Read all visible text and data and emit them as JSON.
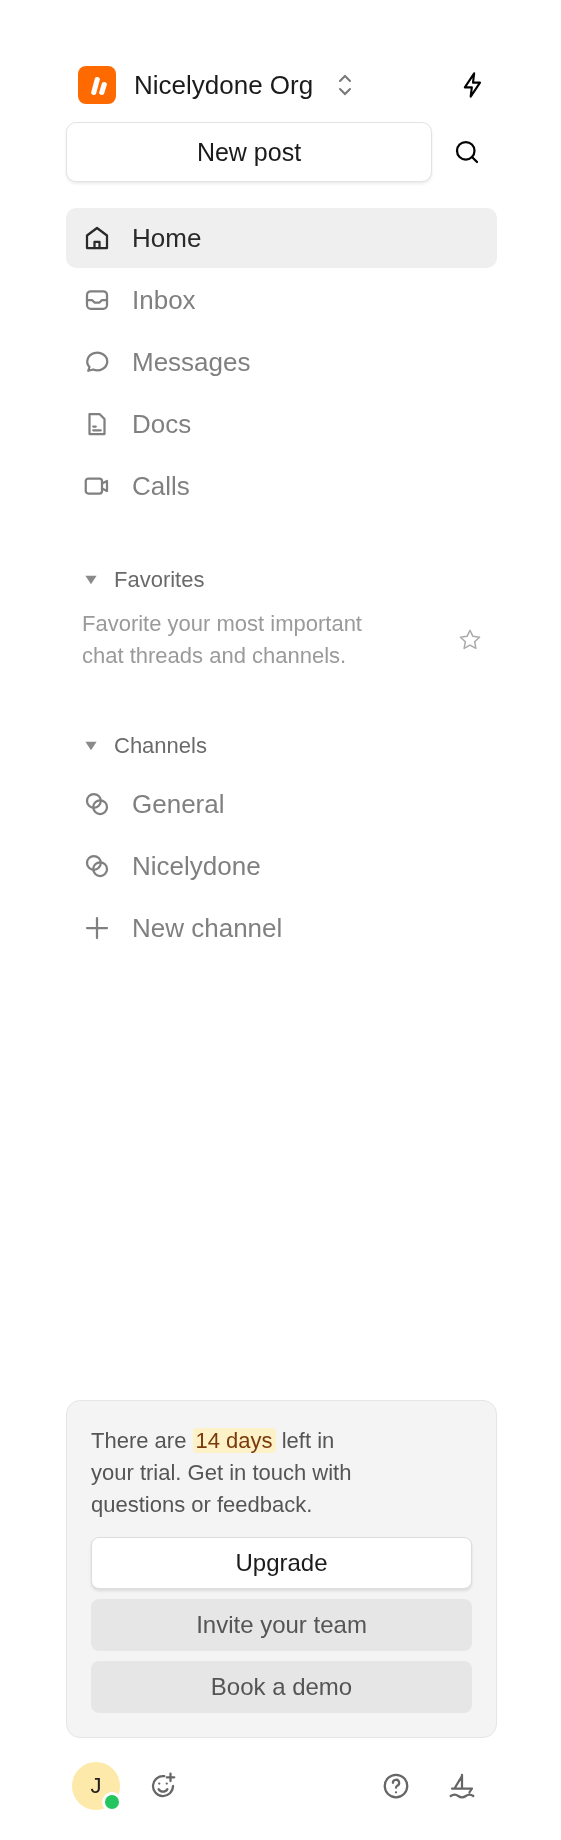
{
  "org": {
    "name": "Nicelydone Org"
  },
  "new_post": {
    "label": "New post"
  },
  "nav": [
    {
      "label": "Home",
      "kind": "home",
      "selected": true
    },
    {
      "label": "Inbox",
      "kind": "inbox",
      "selected": false
    },
    {
      "label": "Messages",
      "kind": "message",
      "selected": false
    },
    {
      "label": "Docs",
      "kind": "doc",
      "selected": false
    },
    {
      "label": "Calls",
      "kind": "video",
      "selected": false
    }
  ],
  "favorites": {
    "title": "Favorites",
    "expanded": true,
    "hint": "Favorite your most important chat threads and channels."
  },
  "channels": {
    "title": "Channels",
    "expanded": true,
    "items": [
      {
        "label": "General",
        "kind": "channel"
      },
      {
        "label": "Nicelydone",
        "kind": "channel"
      },
      {
        "label": "New channel",
        "kind": "add"
      }
    ]
  },
  "trial": {
    "text": "There are **14 days** left in your trial. Get in touch with questions or feedback.",
    "buttons": [
      {
        "label": "Upgrade",
        "kind": "primary"
      },
      {
        "label": "Invite your team",
        "kind": "secondary"
      },
      {
        "label": "Book a demo",
        "kind": "secondary"
      }
    ]
  },
  "user": {
    "initial": "J",
    "online": true
  }
}
